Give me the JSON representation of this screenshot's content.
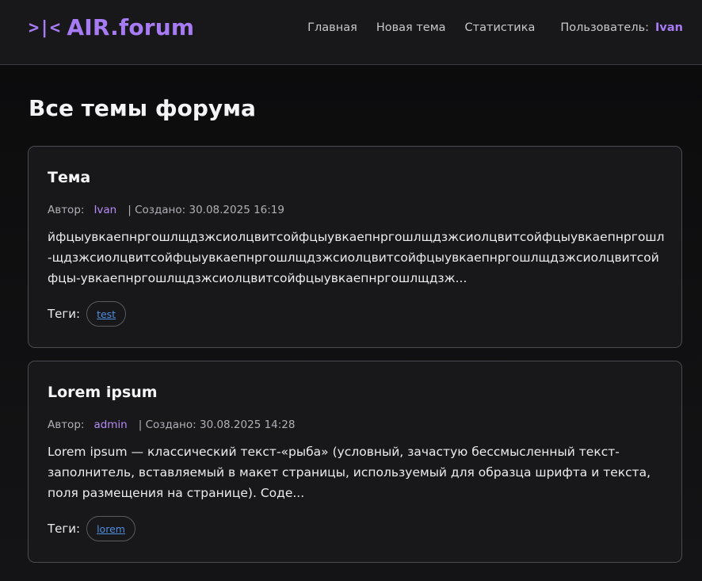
{
  "header": {
    "logo_mark": ">|<",
    "logo_text": "AIR.forum",
    "nav": {
      "home": "Главная",
      "new_topic": "Новая тема",
      "stats": "Статистика"
    },
    "user_label": "Пользователь:",
    "user_name": "Ivan"
  },
  "main": {
    "page_title": "Все темы форума",
    "topics": [
      {
        "title": "Тема",
        "author_label": "Автор:",
        "author": "Ivan",
        "created": "| Создано: 30.08.2025 16:19",
        "excerpt": "йфцыувкаепнргошлщдзжсиолцвитсойфцыувкаепнргошлщдзжсиолцвитсойфцыувкаепнргошл-щдзжсиолцвитсойфцыувкаепнргошлщдзжсиолцвитсойфцыувкаепнргошлщдзжсиолцвитсойфцы-увкаепнргошлщдзжсиолцвитсойфцыувкаепнргошлщдзж...",
        "tags_label": "Теги:",
        "tags": [
          "test"
        ]
      },
      {
        "title": "Lorem ipsum",
        "author_label": "Автор:",
        "author": "admin",
        "created": "| Создано: 30.08.2025 14:28",
        "excerpt": "Lorem ipsum — классический текст-«рыба» (условный, зачастую бессмысленный текст-заполнитель, вставляемый в макет страницы, используемый для образца шрифта и текста, поля размещения на странице). Соде...",
        "tags_label": "Теги:",
        "tags": [
          "lorem"
        ]
      }
    ]
  },
  "colors": {
    "accent": "#a77bf3",
    "background": "#0f0f11",
    "card": "#18181b",
    "tag_link": "#4e8fe0"
  }
}
